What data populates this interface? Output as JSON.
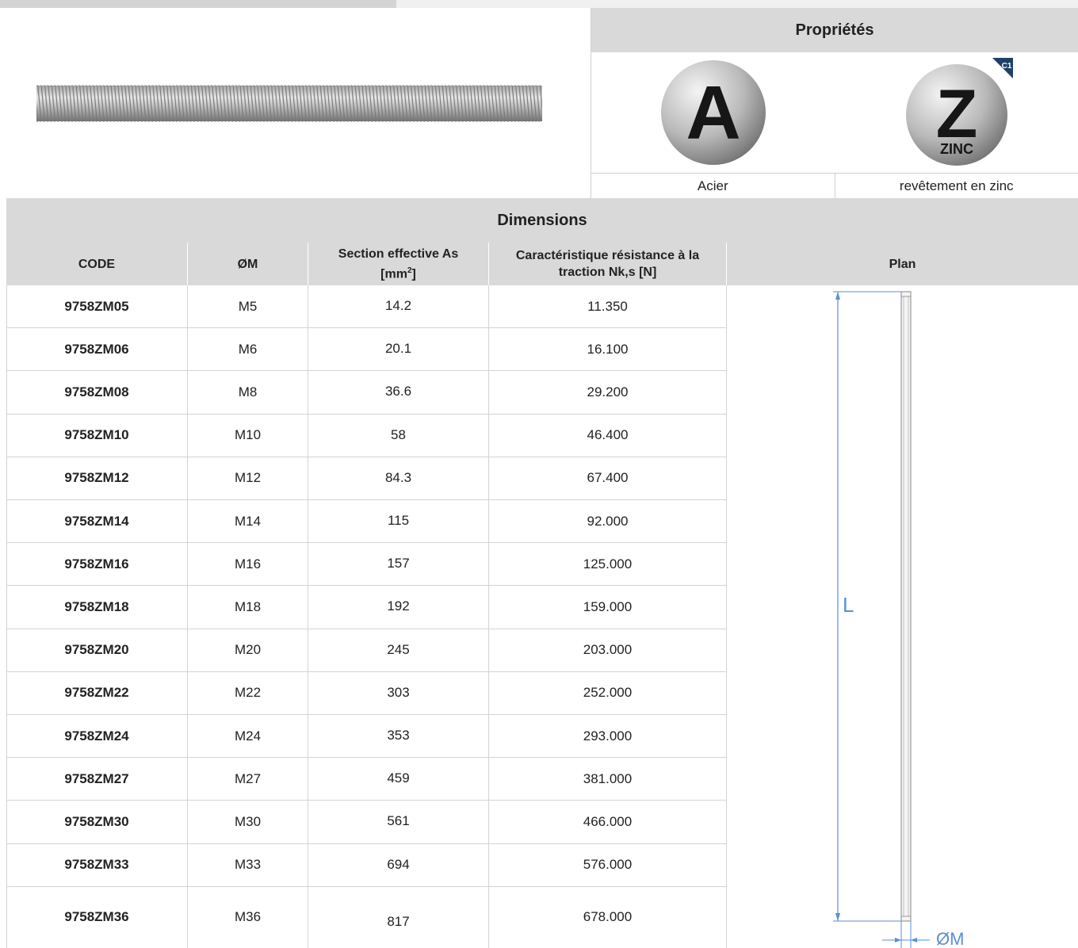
{
  "properties": {
    "title": "Propriétés",
    "items": [
      {
        "badge": "A",
        "label": "Acier",
        "icon": "steel-icon"
      },
      {
        "badge": "Z",
        "subbadge": "ZINC",
        "corner": "C1",
        "label": "revêtement en zinc",
        "icon": "zinc-coating-icon"
      }
    ]
  },
  "dimensions": {
    "title": "Dimensions",
    "columns": {
      "code": "CODE",
      "diameter": "ØM",
      "section": "Section effective As [mm2]",
      "section_main": "Section effective As",
      "section_unit_pre": "[mm",
      "section_unit_sup": "2",
      "section_unit_post": "]",
      "tensile_line1": "Caractéristique résistance à la",
      "tensile_line2": "traction Nk,s [N]",
      "plan": "Plan"
    },
    "rows": [
      {
        "code": "9758ZM05",
        "diameter": "M5",
        "section": "14.2",
        "tensile": "11.350"
      },
      {
        "code": "9758ZM06",
        "diameter": "M6",
        "section": "20.1",
        "tensile": "16.100"
      },
      {
        "code": "9758ZM08",
        "diameter": "M8",
        "section": "36.6",
        "tensile": "29.200"
      },
      {
        "code": "9758ZM10",
        "diameter": "M10",
        "section": "58",
        "tensile": "46.400"
      },
      {
        "code": "9758ZM12",
        "diameter": "M12",
        "section": "84.3",
        "tensile": "67.400"
      },
      {
        "code": "9758ZM14",
        "diameter": "M14",
        "section": "115",
        "tensile": "92.000"
      },
      {
        "code": "9758ZM16",
        "diameter": "M16",
        "section": "157",
        "tensile": "125.000"
      },
      {
        "code": "9758ZM18",
        "diameter": "M18",
        "section": "192",
        "tensile": "159.000"
      },
      {
        "code": "9758ZM20",
        "diameter": "M20",
        "section": "245",
        "tensile": "203.000"
      },
      {
        "code": "9758ZM22",
        "diameter": "M22",
        "section": "303",
        "tensile": "252.000"
      },
      {
        "code": "9758ZM24",
        "diameter": "M24",
        "section": "353",
        "tensile": "293.000"
      },
      {
        "code": "9758ZM27",
        "diameter": "M27",
        "section": "459",
        "tensile": "381.000"
      },
      {
        "code": "9758ZM30",
        "diameter": "M30",
        "section": "561",
        "tensile": "466.000"
      },
      {
        "code": "9758ZM33",
        "diameter": "M33",
        "section": "694",
        "tensile": "576.000"
      },
      {
        "code": "9758ZM36",
        "diameter": "M36",
        "section": "817",
        "tensile": "678.000"
      }
    ]
  },
  "plan": {
    "length_label": "L",
    "diameter_label": "ØM"
  },
  "colors": {
    "header_bg": "#d9d9d9",
    "grid": "#d4d4d4",
    "dimension_blue": "#5b8fd6"
  }
}
